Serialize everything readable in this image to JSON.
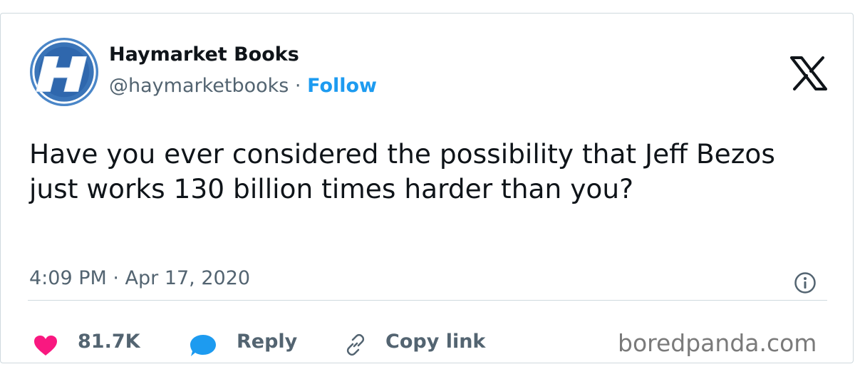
{
  "author": {
    "name": "Haymarket Books",
    "handle": "@haymarketbooks",
    "separator": " · ",
    "follow_label": "Follow",
    "avatar_icon": "haymarket-h-logo"
  },
  "platform_icon": "x-logo-icon",
  "tweet": {
    "text": "Have you ever considered the possibility that Jeff Bezos just works 130 billion times harder than you?",
    "timestamp": "4:09 PM · Apr 17, 2020"
  },
  "actions": {
    "likes_count": "81.7K",
    "reply_label": "Reply",
    "copy_link_label": "Copy link"
  },
  "watermark": "boredpanda.com",
  "colors": {
    "accent": "#1d9bf0",
    "heart": "#f91880",
    "text_primary": "#0f1419",
    "text_secondary": "#536471"
  }
}
